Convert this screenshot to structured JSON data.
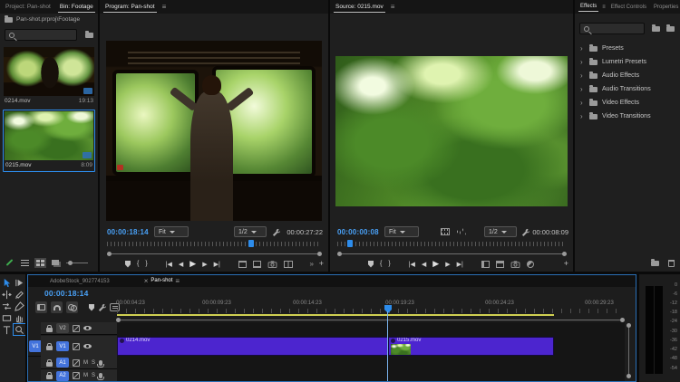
{
  "icons": {
    "menu": "≡",
    "overflow": "»",
    "close": "×",
    "chevron": "›",
    "brace_open": "{",
    "brace_close": "}",
    "go_to_in": "|◀",
    "step_back": "◀",
    "play": "▶",
    "step_fwd": "▶",
    "go_to_out": "▶|",
    "plus": "+"
  },
  "project_panel": {
    "tab_inactive": "Project: Pan-shot",
    "tab_active": "Bin: Footage",
    "breadcrumb": "Pan-shot.prproj\\Footage",
    "clips": [
      {
        "name": "0214.mov",
        "duration": "19:13"
      },
      {
        "name": "0215.mov",
        "duration": "8:09"
      }
    ]
  },
  "program_monitor": {
    "title": "Program: Pan-shot",
    "timecode": "00:00:18:14",
    "fit": "Fit",
    "resolution": "1/2",
    "duration": "00:00:27:22"
  },
  "source_monitor": {
    "title": "Source: 0215.mov",
    "timecode": "00:00:00:08",
    "fit": "Fit",
    "resolution": "1/2",
    "duration": "00:00:08:09"
  },
  "effects_panel": {
    "tab_active": "Effects",
    "tab_effect_controls": "Effect Controls",
    "tab_properties": "Properties",
    "folders": [
      {
        "label": "Presets"
      },
      {
        "label": "Lumetri Presets"
      },
      {
        "label": "Audio Effects"
      },
      {
        "label": "Audio Transitions"
      },
      {
        "label": "Video Effects"
      },
      {
        "label": "Video Transitions"
      }
    ]
  },
  "timeline": {
    "tab_inactive": "AdobeStock_902774153",
    "tab_active": "Pan-shot",
    "timecode": "00:00:18:14",
    "ruler_labels": [
      "00:00:04:23",
      "00:00:09:23",
      "00:00:14:23",
      "00:00:19:23",
      "00:00:24:23",
      "00:00:29:23"
    ],
    "tracks": {
      "v2": "V2",
      "v1": "V1",
      "a1": "A1",
      "a2": "A2",
      "v1_patch": "V1",
      "mute": "M",
      "solo": "S"
    },
    "clips": [
      {
        "name": "0214.mov"
      },
      {
        "name": "0215.mov"
      }
    ]
  },
  "audio_meters": {
    "labels": [
      "0",
      "-6",
      "-12",
      "-18",
      "-24",
      "-30",
      "-36",
      "-42",
      "-48",
      "-54"
    ]
  },
  "colors": {
    "accent_blue": "#2d8ceb",
    "timecode_blue": "#49a1f7",
    "clip_purple": "#4c25cf",
    "track_target_blue": "#4373dc",
    "work_area_yellow": "#d0d052"
  }
}
